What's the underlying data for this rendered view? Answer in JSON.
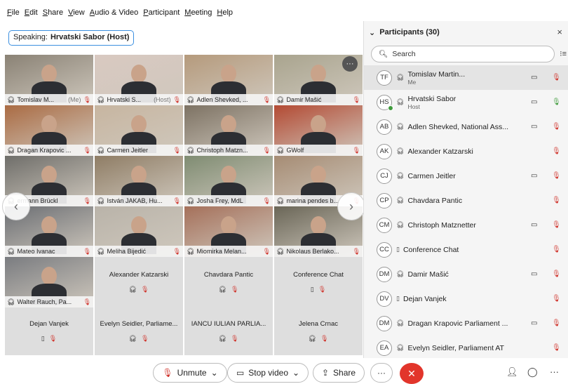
{
  "menu": [
    "File",
    "Edit",
    "Share",
    "View",
    "Audio & Video",
    "Participant",
    "Meeting",
    "Help"
  ],
  "speaking": {
    "label": "Speaking:",
    "name": "Hrvatski Sabor (Host)"
  },
  "grid": {
    "tiles": [
      {
        "name": "Tomislav M...",
        "suffix": "(Me)",
        "bg": "#8a8275"
      },
      {
        "name": "Hrvatski S...",
        "suffix": "(Host)",
        "bg": "#d9c9c1"
      },
      {
        "name": "Adlen Shevked, ...",
        "suffix": "",
        "bg": "#b59a7c"
      },
      {
        "name": "Damir Mašić",
        "suffix": "",
        "bg": "#a9a48e"
      },
      {
        "name": "Dragan Krapovic ...",
        "suffix": "",
        "bg": "#aa6b43"
      },
      {
        "name": "Carmen Jeitler",
        "suffix": "",
        "bg": "#c7b5a0"
      },
      {
        "name": "Christoph Matzn...",
        "suffix": "",
        "bg": "#7d7263"
      },
      {
        "name": "GWolf",
        "suffix": "",
        "bg": "#b34a33"
      },
      {
        "name": "ermann Brückl",
        "suffix": "",
        "bg": "#6f6e6a"
      },
      {
        "name": "István JAKAB, Hu...",
        "suffix": "",
        "bg": "#8f7d65"
      },
      {
        "name": "Josha Frey, MdL",
        "suffix": "",
        "bg": "#7f8c72"
      },
      {
        "name": "marina pendes b...",
        "suffix": "",
        "bg": "#a68c74"
      },
      {
        "name": "Mateo Ivanac",
        "suffix": "",
        "bg": "#6b6e73"
      },
      {
        "name": "Meliha Bijedić",
        "suffix": "",
        "bg": "#b9b3a9"
      },
      {
        "name": "Miomirka Melan...",
        "suffix": "",
        "bg": "#a5705a"
      },
      {
        "name": "Nikolaus Berlako...",
        "suffix": "",
        "bg": "#6a6657"
      },
      {
        "name": "Walter Rauch, Pa...",
        "suffix": "",
        "bg": "#7a7c80"
      }
    ],
    "empty_tiles": [
      {
        "name": "Alexander Katzarski",
        "icon": "headphones"
      },
      {
        "name": "Chavdara Pantic",
        "icon": "headphones"
      },
      {
        "name": "Conference Chat",
        "icon": "phone"
      },
      {
        "name": "Dejan Vanjek",
        "icon": "phone"
      },
      {
        "name": "Evelyn Seidler, Parliame...",
        "icon": "headphones"
      },
      {
        "name": "IANCU IULIAN PARLIA...",
        "icon": "headphones"
      },
      {
        "name": "Jelena Crnac",
        "icon": "headphones"
      }
    ]
  },
  "panel": {
    "title": "Participants (30)",
    "search_placeholder": "Search",
    "participants": [
      {
        "initials": "TF",
        "name": "Tomislav Martin...",
        "sub": "Me",
        "cam": true,
        "mic": "muted",
        "me": true
      },
      {
        "initials": "HS",
        "name": "Hrvatski Sabor",
        "sub": "Host",
        "cam": true,
        "mic": "on",
        "dot": true
      },
      {
        "initials": "AB",
        "name": "Adlen Shevked, National Ass...",
        "sub": "",
        "cam": true,
        "mic": "muted"
      },
      {
        "initials": "AK",
        "name": "Alexander Katzarski",
        "sub": "",
        "cam": false,
        "mic": "muted"
      },
      {
        "initials": "CJ",
        "name": "Carmen Jeitler",
        "sub": "",
        "cam": true,
        "mic": "muted"
      },
      {
        "initials": "CP",
        "name": "Chavdara Pantic",
        "sub": "",
        "cam": false,
        "mic": "muted"
      },
      {
        "initials": "CM",
        "name": "Christoph Matznetter",
        "sub": "",
        "cam": true,
        "mic": "muted"
      },
      {
        "initials": "CC",
        "name": "Conference Chat",
        "sub": "",
        "cam": false,
        "mic": "muted",
        "phone": true
      },
      {
        "initials": "DM",
        "name": "Damir Mašić",
        "sub": "",
        "cam": true,
        "mic": "muted"
      },
      {
        "initials": "DV",
        "name": "Dejan Vanjek",
        "sub": "",
        "cam": false,
        "mic": "muted",
        "phone": true
      },
      {
        "initials": "DM",
        "name": "Dragan Krapovic Parliament ...",
        "sub": "",
        "cam": true,
        "mic": "muted"
      },
      {
        "initials": "EA",
        "name": "Evelyn Seidler, Parliament AT",
        "sub": "",
        "cam": false,
        "mic": "muted"
      }
    ]
  },
  "controls": {
    "unmute": "Unmute",
    "stop_video": "Stop video",
    "share": "Share",
    "more": "···"
  },
  "colors": {
    "accent": "#2d8cf0",
    "end": "#e2352b",
    "muted": "#d0342c",
    "unmuted": "#3f9b3c"
  }
}
